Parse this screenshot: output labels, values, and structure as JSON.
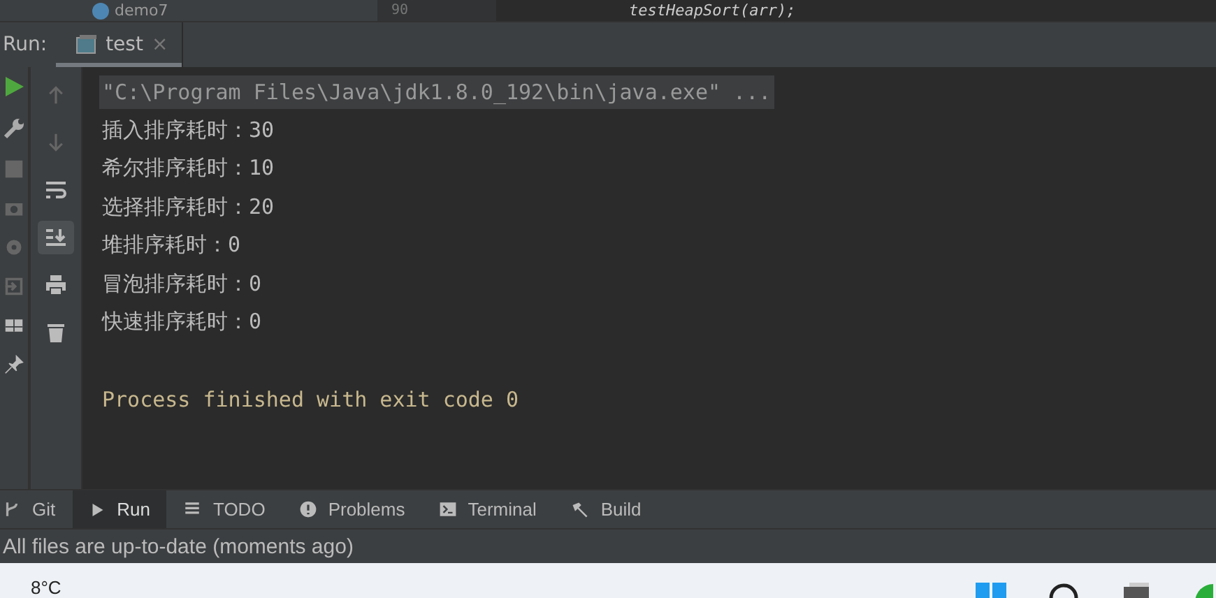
{
  "top_strip": {
    "project_item": "demo7",
    "line_number": "90",
    "code_line": "testHeapSort(arr);"
  },
  "run_panel": {
    "label": "Run:",
    "tabs": [
      {
        "label": "test",
        "selected": true,
        "close": "×"
      }
    ],
    "console": {
      "lines": [
        {
          "kind": "command",
          "text": "\"C:\\Program Files\\Java\\jdk1.8.0_192\\bin\\java.exe\" ..."
        },
        {
          "kind": "output",
          "text": "插入排序耗时：30"
        },
        {
          "kind": "output",
          "text": "希尔排序耗时：10"
        },
        {
          "kind": "output",
          "text": "选择排序耗时：20"
        },
        {
          "kind": "output",
          "text": "堆排序耗时：0"
        },
        {
          "kind": "output",
          "text": "冒泡排序耗时：0"
        },
        {
          "kind": "output",
          "text": "快速排序耗时：0"
        },
        {
          "kind": "blank"
        },
        {
          "kind": "output",
          "text": "Process finished with exit code 0"
        }
      ]
    }
  },
  "tool_tabs": [
    {
      "label": "Git",
      "kind": "git",
      "selected": false
    },
    {
      "label": "Run",
      "kind": "run",
      "selected": true
    },
    {
      "label": "TODO",
      "kind": "todo",
      "selected": false
    },
    {
      "label": "Problems",
      "kind": "problems",
      "selected": false
    },
    {
      "label": "Terminal",
      "kind": "terminal",
      "selected": false
    },
    {
      "label": "Build",
      "kind": "build",
      "selected": false
    }
  ],
  "status_bar": "All files are up-to-date (moments ago)",
  "taskbar": {
    "weather": "8°C"
  }
}
